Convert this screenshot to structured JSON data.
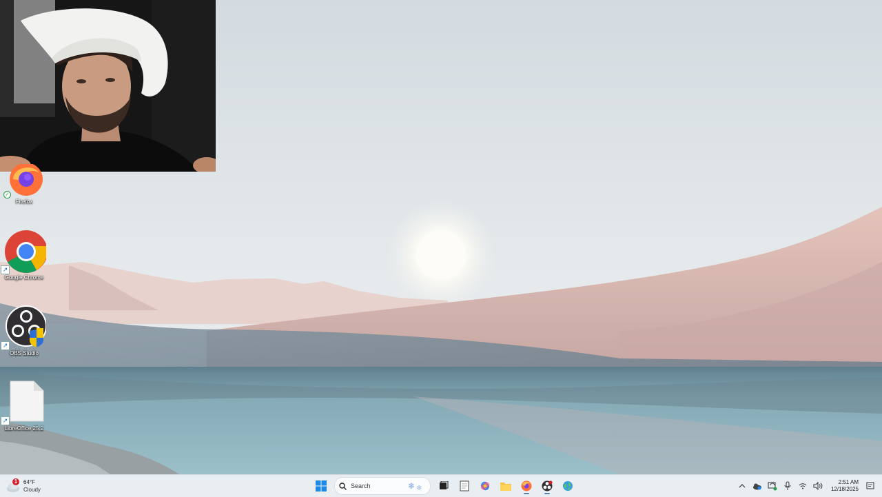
{
  "desktop": {
    "icons": [
      {
        "label": "Firefox",
        "icon": "firefox-icon",
        "overlay": "sync-check"
      },
      {
        "label": "Google Chrome",
        "icon": "chrome-icon",
        "overlay": "shortcut-arrow"
      },
      {
        "label": "OBS Studio",
        "icon": "obs-icon",
        "overlay": "shortcut-arrow"
      },
      {
        "label": "LibreOffice 25.2",
        "icon": "document-icon",
        "overlay": "shortcut-arrow"
      }
    ]
  },
  "taskbar": {
    "weather": {
      "badge": "1",
      "temperature": "64°F",
      "condition": "Cloudy",
      "icon": "cloud-icon"
    },
    "search": {
      "placeholder": "Search"
    },
    "pinned": [
      {
        "name": "windows-start",
        "icon": "windows-logo-icon"
      },
      {
        "name": "task-view",
        "icon": "task-view-icon"
      },
      {
        "name": "notepad",
        "icon": "notepad-icon"
      },
      {
        "name": "copilot",
        "icon": "copilot-icon"
      },
      {
        "name": "file-explorer",
        "icon": "folder-icon"
      },
      {
        "name": "firefox",
        "icon": "firefox-icon",
        "active": true
      },
      {
        "name": "obs-studio",
        "icon": "obs-icon",
        "active": true
      },
      {
        "name": "globe-app",
        "icon": "globe-icon"
      }
    ],
    "tray": {
      "icons": [
        "chevron-up-icon",
        "onedrive-icon",
        "sync-icon",
        "microphone-icon",
        "wifi-icon",
        "volume-icon"
      ],
      "time": "2:51 AM",
      "date": "12/18/2025",
      "notification_icon": "notification-icon"
    }
  },
  "colors": {
    "sky": "#dde4e8",
    "dune": "#d9b9b1",
    "water": "#8fb6c2",
    "taskbar": "#e9eef2",
    "accent": "#2b6fd1"
  }
}
